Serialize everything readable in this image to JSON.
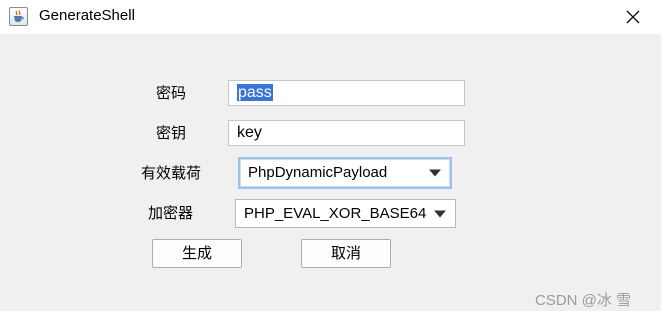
{
  "window": {
    "title": "GenerateShell",
    "icon": "java-cup-icon",
    "close_icon": "close-icon"
  },
  "form": {
    "password": {
      "label": "密码",
      "value": "pass"
    },
    "secret_key": {
      "label": "密钥",
      "value": "key"
    },
    "payload": {
      "label": "有效载荷",
      "selected": "PhpDynamicPayload"
    },
    "encryptor": {
      "label": "加密器",
      "selected": "PHP_EVAL_XOR_BASE64"
    }
  },
  "buttons": {
    "generate_label": "生成",
    "cancel_label": "取消"
  },
  "watermark": "CSDN @冰 雪",
  "colors": {
    "window_bg": "#f0f0f0",
    "titlebar_bg": "#ffffff",
    "selection": "#3875d7",
    "focus_border": "#9ec1ea"
  }
}
